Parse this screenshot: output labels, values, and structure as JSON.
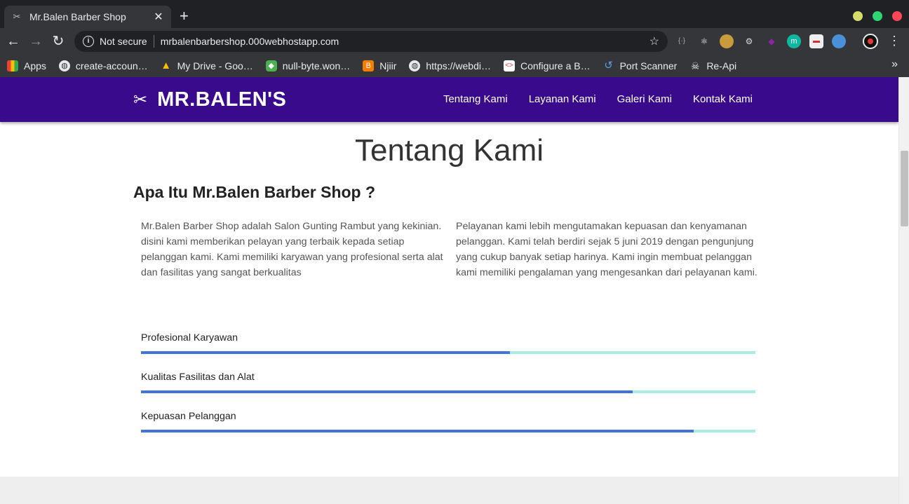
{
  "browser": {
    "tab_title": "Mr.Balen Barber Shop",
    "tab_close": "✕",
    "new_tab": "+",
    "back": "←",
    "forward": "→",
    "reload": "↻",
    "security_label": "Not secure",
    "url": "mrbalenbarbershop.000webhostapp.com",
    "star": "☆",
    "menu": "⋮",
    "window_colors": [
      "#d8dc6a",
      "#2ed573",
      "#ff4757"
    ]
  },
  "bookmarks": {
    "items": [
      {
        "label": "Apps",
        "icon": "apps-grid-icon"
      },
      {
        "label": "create-accoun…",
        "icon": "globe-icon"
      },
      {
        "label": "My Drive - Goo…",
        "icon": "drive-icon"
      },
      {
        "label": "null-byte.won…",
        "icon": "wonderhowto-icon"
      },
      {
        "label": "Njiir",
        "icon": "blogger-icon"
      },
      {
        "label": "https://webdi…",
        "icon": "globe-icon"
      },
      {
        "label": "Configure a B…",
        "icon": "code-icon"
      },
      {
        "label": "Port Scanner",
        "icon": "refresh-icon"
      },
      {
        "label": "Re-Api",
        "icon": "pirate-icon"
      }
    ],
    "more": "»"
  },
  "site": {
    "brand": "MR.BALEN'S",
    "nav": [
      "Tentang Kami",
      "Layanan Kami",
      "Galeri Kami",
      "Kontak Kami"
    ],
    "section_title": "Tentang Kami",
    "sub_title": "Apa Itu Mr.Balen Barber Shop ?",
    "para_left": "Mr.Balen Barber Shop adalah Salon Gunting Rambut yang kekinian. disini kami memberikan pelayan yang terbaik kepada setiap pelanggan kami. Kami memiliki karyawan yang profesional serta alat dan fasilitas yang sangat berkualitas",
    "para_right": "Pelayanan kami lebih mengutamakan kepuasan dan kenyamanan pelanggan. Kami telah berdiri sejak 5 juni 2019 dengan pengunjung yang cukup banyak setiap harinya. Kami ingin membuat pelanggan kami memiliki pengalaman yang mengesankan dari pelayanan kami.",
    "skills": [
      {
        "label": "Profesional Karyawan",
        "percent": 60
      },
      {
        "label": "Kualitas Fasilitas dan Alat",
        "percent": 80
      },
      {
        "label": "Kepuasan Pelanggan",
        "percent": 90
      }
    ],
    "colors": {
      "navbar": "#3a0a8c",
      "progress_fill": "#4472d9",
      "progress_track": "#a8ece6"
    }
  }
}
